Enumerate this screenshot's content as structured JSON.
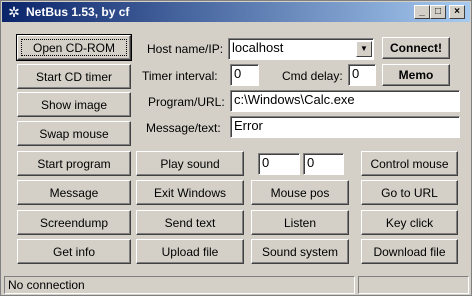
{
  "window": {
    "title": "NetBus 1.53, by cf",
    "app_icon": "netbus-icon",
    "controls": {
      "minimize": "_",
      "maximize": "□",
      "close": "×"
    }
  },
  "left_buttons": [
    "Open CD-ROM",
    "Start CD timer",
    "Show image",
    "Swap mouse"
  ],
  "host": {
    "label": "Host name/IP:",
    "value": "localhost",
    "connect": "Connect!"
  },
  "timer": {
    "label": "Timer interval:",
    "value": "0",
    "cmd_delay_label": "Cmd delay:",
    "cmd_delay_value": "0",
    "memo": "Memo"
  },
  "program": {
    "label": "Program/URL:",
    "value": "c:\\Windows\\Calc.exe"
  },
  "message": {
    "label": "Message/text:",
    "value": "Error"
  },
  "grid": {
    "row1": [
      "Start program",
      "Play sound",
      "Control mouse"
    ],
    "row1_fields": [
      "0",
      "0"
    ],
    "row2": [
      "Message",
      "Exit Windows",
      "Mouse pos",
      "Go to URL"
    ],
    "row3": [
      "Screendump",
      "Send text",
      "Listen",
      "Key click"
    ],
    "row4": [
      "Get info",
      "Upload file",
      "Sound system",
      "Download file"
    ]
  },
  "status": {
    "text": "No connection",
    "right": ""
  }
}
